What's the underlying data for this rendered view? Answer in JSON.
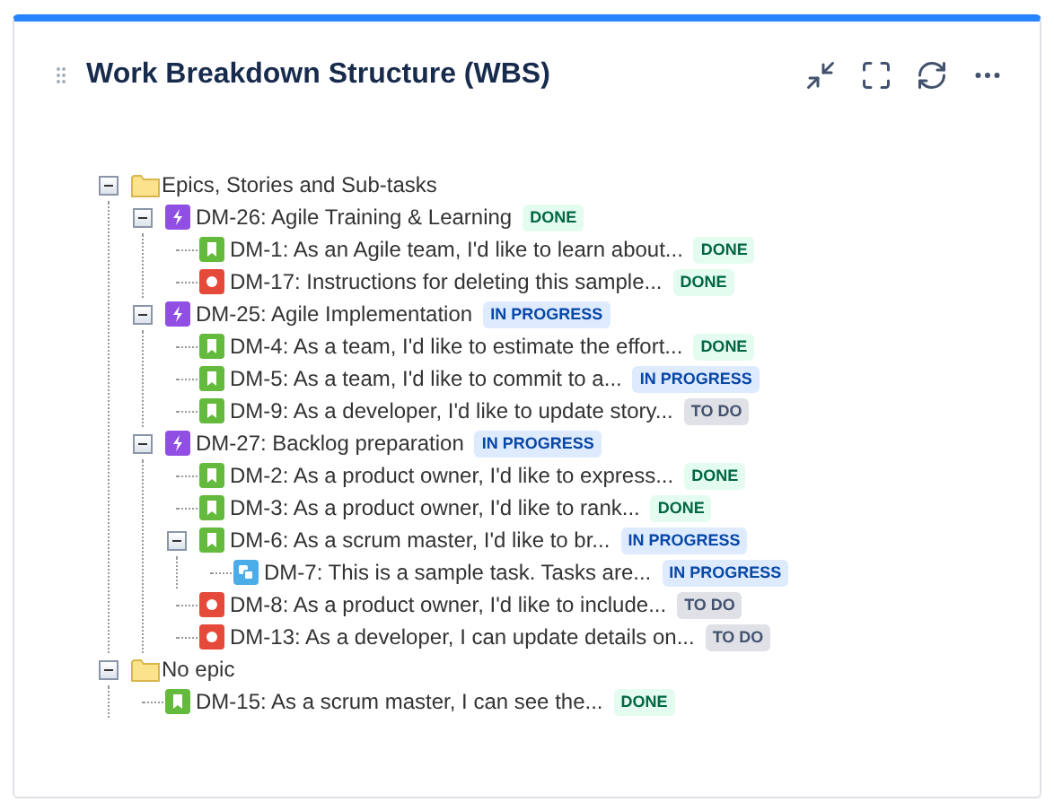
{
  "panel": {
    "title": "Work Breakdown Structure (WBS)"
  },
  "tree": [
    {
      "kind": "folder",
      "label": "Epics, Stories and Sub-tasks",
      "expanded": true,
      "children": [
        {
          "kind": "epic",
          "label": "DM-26: Agile Training & Learning",
          "status": {
            "kind": "done",
            "text": "DONE"
          },
          "expanded": true,
          "children": [
            {
              "kind": "story",
              "label": "DM-1: As an Agile team, I'd like to learn about...",
              "status": {
                "kind": "done",
                "text": "DONE"
              }
            },
            {
              "kind": "bug",
              "label": "DM-17: Instructions for deleting this sample...",
              "status": {
                "kind": "done",
                "text": "DONE"
              }
            }
          ]
        },
        {
          "kind": "epic",
          "label": "DM-25: Agile Implementation",
          "status": {
            "kind": "in_progress",
            "text": "IN PROGRESS"
          },
          "expanded": true,
          "children": [
            {
              "kind": "story",
              "label": "DM-4: As a team, I'd like to estimate the effort...",
              "status": {
                "kind": "done",
                "text": "DONE"
              }
            },
            {
              "kind": "story",
              "label": "DM-5: As a team, I'd like to commit to a...",
              "status": {
                "kind": "in_progress",
                "text": "IN PROGRESS"
              }
            },
            {
              "kind": "story",
              "label": "DM-9: As a developer, I'd like to update story...",
              "status": {
                "kind": "todo",
                "text": "TO DO"
              }
            }
          ]
        },
        {
          "kind": "epic",
          "label": "DM-27: Backlog preparation",
          "status": {
            "kind": "in_progress",
            "text": "IN PROGRESS"
          },
          "expanded": true,
          "children": [
            {
              "kind": "story",
              "label": "DM-2: As a product owner, I'd like to express...",
              "status": {
                "kind": "done",
                "text": "DONE"
              }
            },
            {
              "kind": "story",
              "label": "DM-3: As a product owner, I'd like to rank...",
              "status": {
                "kind": "done",
                "text": "DONE"
              }
            },
            {
              "kind": "story",
              "label": "DM-6: As a scrum master, I'd like to br...",
              "status": {
                "kind": "in_progress",
                "text": "IN PROGRESS"
              },
              "expanded": true,
              "children": [
                {
                  "kind": "subtask",
                  "label": "DM-7: This is a sample task. Tasks are...",
                  "status": {
                    "kind": "in_progress",
                    "text": "IN PROGRESS"
                  }
                }
              ]
            },
            {
              "kind": "bug",
              "label": "DM-8: As a product owner, I'd like to include...",
              "status": {
                "kind": "todo",
                "text": "TO DO"
              }
            },
            {
              "kind": "bug",
              "label": "DM-13: As a developer, I can update details on...",
              "status": {
                "kind": "todo",
                "text": "TO DO"
              }
            }
          ]
        }
      ]
    },
    {
      "kind": "folder",
      "label": "No epic",
      "expanded": true,
      "children": [
        {
          "kind": "story",
          "label": "DM-15: As a scrum master, I can see the...",
          "status": {
            "kind": "done",
            "text": "DONE"
          }
        }
      ]
    }
  ]
}
